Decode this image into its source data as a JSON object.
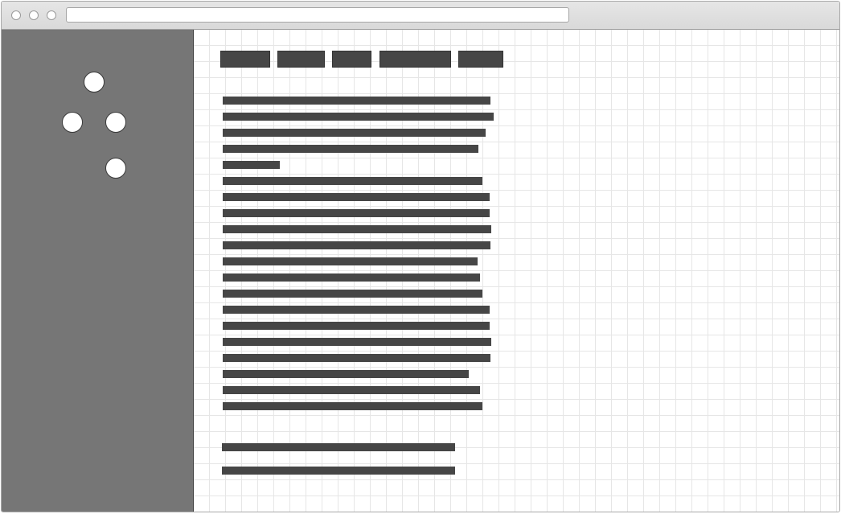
{
  "window": {
    "title": "",
    "address_bar": {
      "value": ""
    },
    "traffic_lights": [
      "close-button",
      "minimize-button",
      "zoom-button"
    ]
  },
  "sidebar": {
    "background": "#767676",
    "controls": [
      "up",
      "left",
      "right",
      "down"
    ]
  },
  "main": {
    "background": "#ffffff",
    "grid_color": "#e6e6e6",
    "nav": {
      "item_count": 5,
      "color": "#464646"
    },
    "body_lines": {
      "count": 20,
      "color": "#464646"
    },
    "footer_lines": {
      "count": 2
    }
  }
}
